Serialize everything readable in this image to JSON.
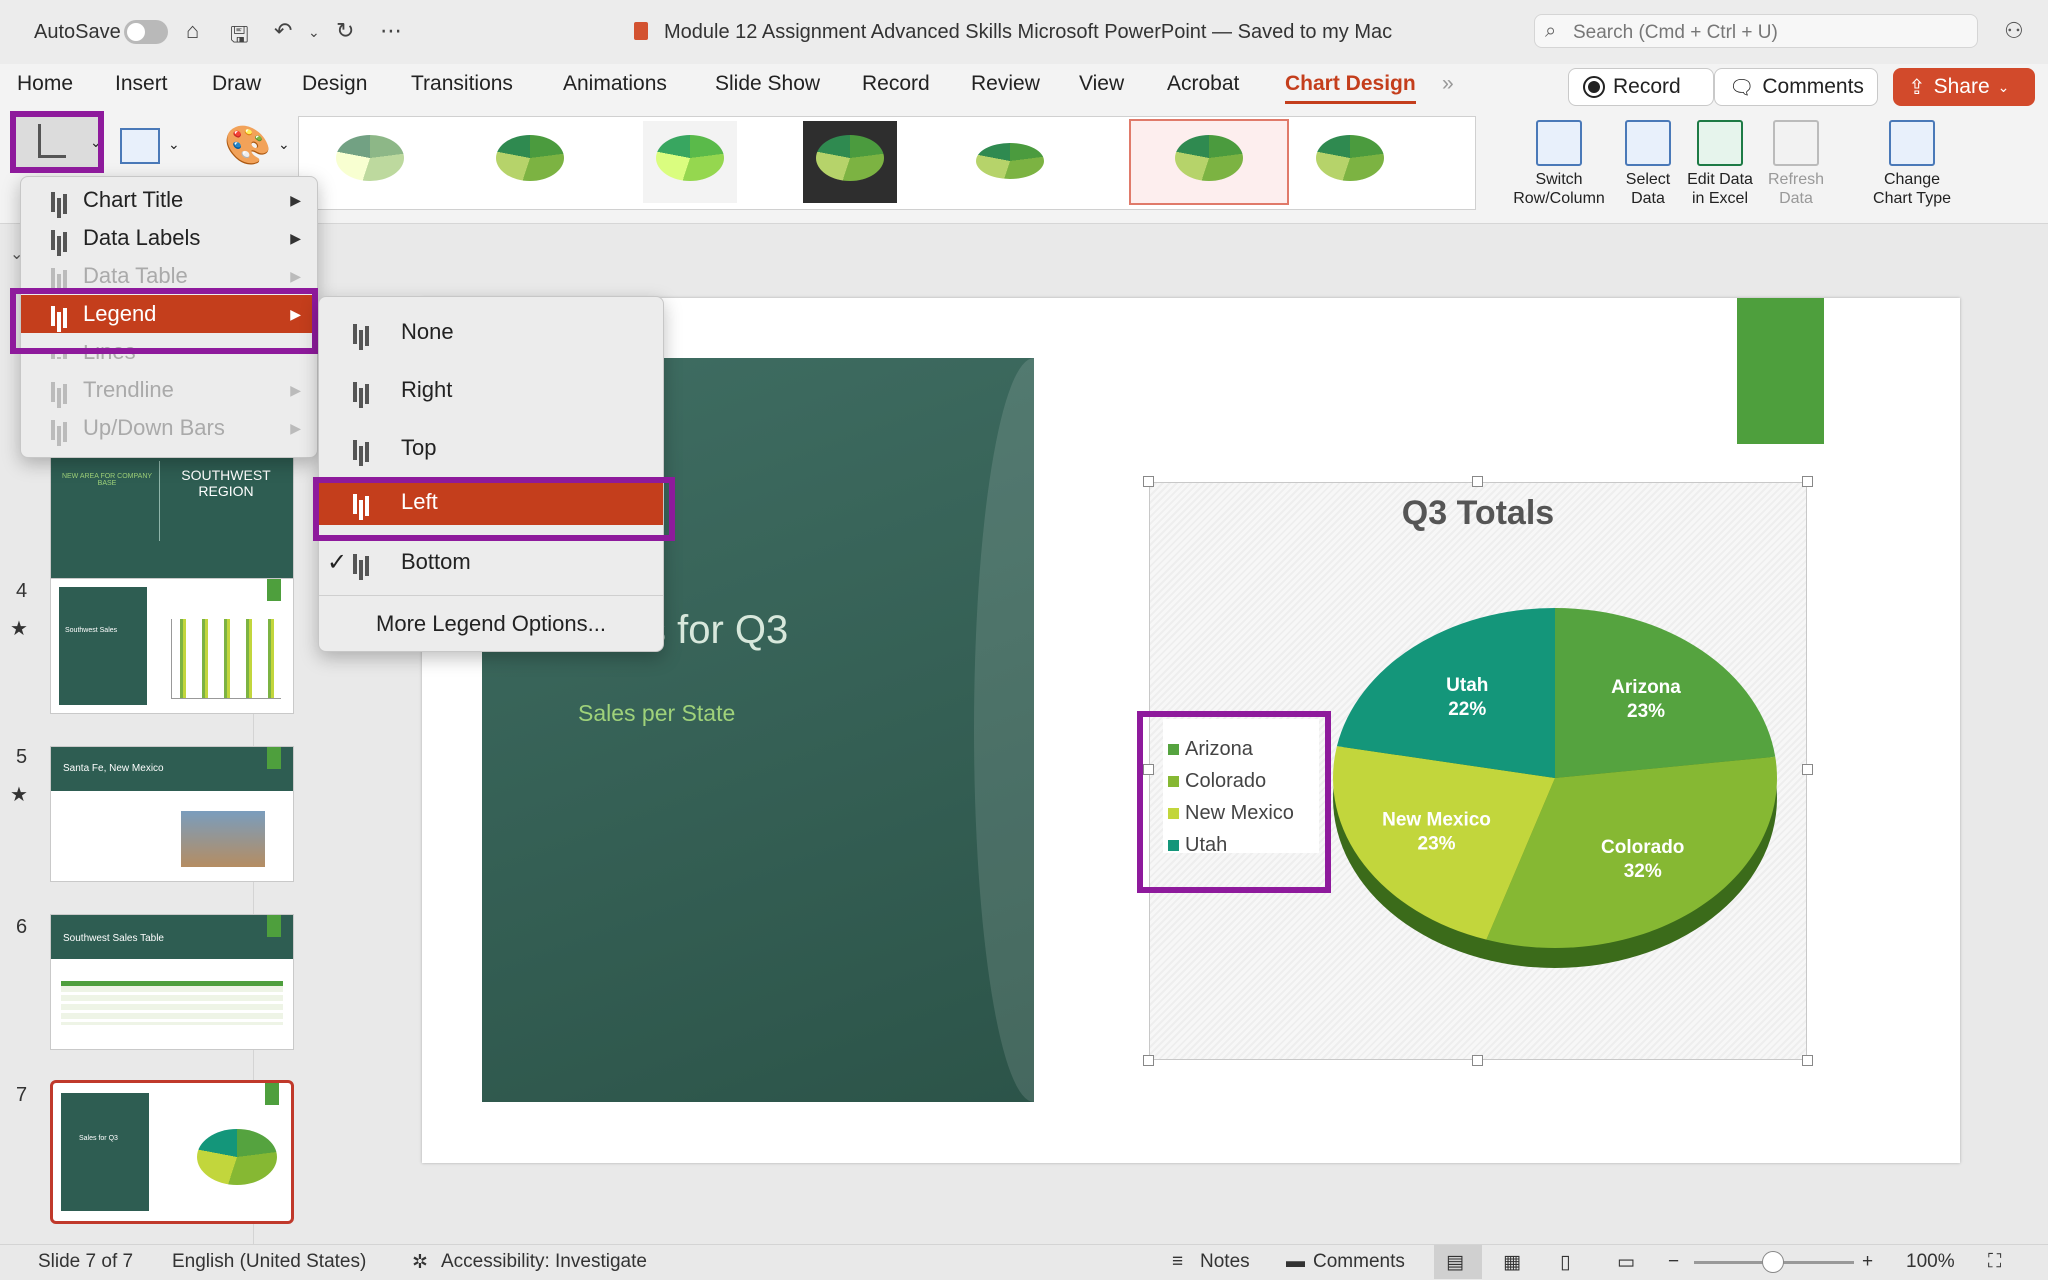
{
  "titlebar": {
    "autosave_label": "AutoSave",
    "document_title": "Module 12 Assignment Advanced Skills Microsoft PowerPoint — Saved to my Mac",
    "search_placeholder": "Search (Cmd + Ctrl + U)"
  },
  "tabs": [
    "Home",
    "Insert",
    "Draw",
    "Design",
    "Transitions",
    "Animations",
    "Slide Show",
    "Record",
    "Review",
    "View",
    "Acrobat",
    "Chart Design"
  ],
  "active_tab": "Chart Design",
  "ribbon_actions": {
    "record": "Record",
    "comments": "Comments",
    "share": "Share"
  },
  "ribbon_buttons": [
    {
      "line1": "Switch",
      "line2": "Row/Column"
    },
    {
      "line1": "Select",
      "line2": "Data"
    },
    {
      "line1": "Edit Data",
      "line2": "in Excel"
    },
    {
      "line1": "Refresh",
      "line2": "Data"
    },
    {
      "line1": "Change",
      "line2": "Chart Type"
    }
  ],
  "add_element_menu": [
    {
      "label": "Chart Title",
      "enabled": true
    },
    {
      "label": "Data Labels",
      "enabled": true
    },
    {
      "label": "Data Table",
      "enabled": false
    },
    {
      "label": "Legend",
      "enabled": true,
      "highlighted": true
    },
    {
      "label": "Lines",
      "enabled": false
    },
    {
      "label": "Trendline",
      "enabled": false
    },
    {
      "label": "Up/Down Bars",
      "enabled": false
    }
  ],
  "legend_submenu": {
    "items": [
      {
        "label": "None"
      },
      {
        "label": "Right"
      },
      {
        "label": "Top"
      },
      {
        "label": "Left",
        "highlighted": true
      },
      {
        "label": "Bottom",
        "checked": true
      }
    ],
    "more": "More Legend Options..."
  },
  "thumbnails": [
    {
      "num": "",
      "title": "SOUTHWEST REGION",
      "caption": "NEW AREA FOR COMPANY BASE"
    },
    {
      "num": "4",
      "title": "Southwest Sales"
    },
    {
      "num": "5",
      "title": "Santa Fe, New Mexico"
    },
    {
      "num": "6",
      "title": "Southwest Sales Table"
    },
    {
      "num": "7",
      "title": "Sales for Q3"
    }
  ],
  "slide": {
    "title_partial": "s for Q3",
    "subtitle": "Sales per State"
  },
  "chart_data": {
    "type": "pie",
    "title": "Q3 Totals",
    "categories": [
      "Arizona",
      "Colorado",
      "New Mexico",
      "Utah"
    ],
    "values": [
      23,
      32,
      23,
      22
    ],
    "unit": "%",
    "colors": [
      "#55a33f",
      "#86b833",
      "#c2d63c",
      "#14967a"
    ],
    "legend_position": "left",
    "three_d": true
  },
  "statusbar": {
    "slide": "Slide 7 of 7",
    "language": "English (United States)",
    "accessibility": "Accessibility: Investigate",
    "notes": "Notes",
    "comments": "Comments",
    "zoom": "100%"
  }
}
